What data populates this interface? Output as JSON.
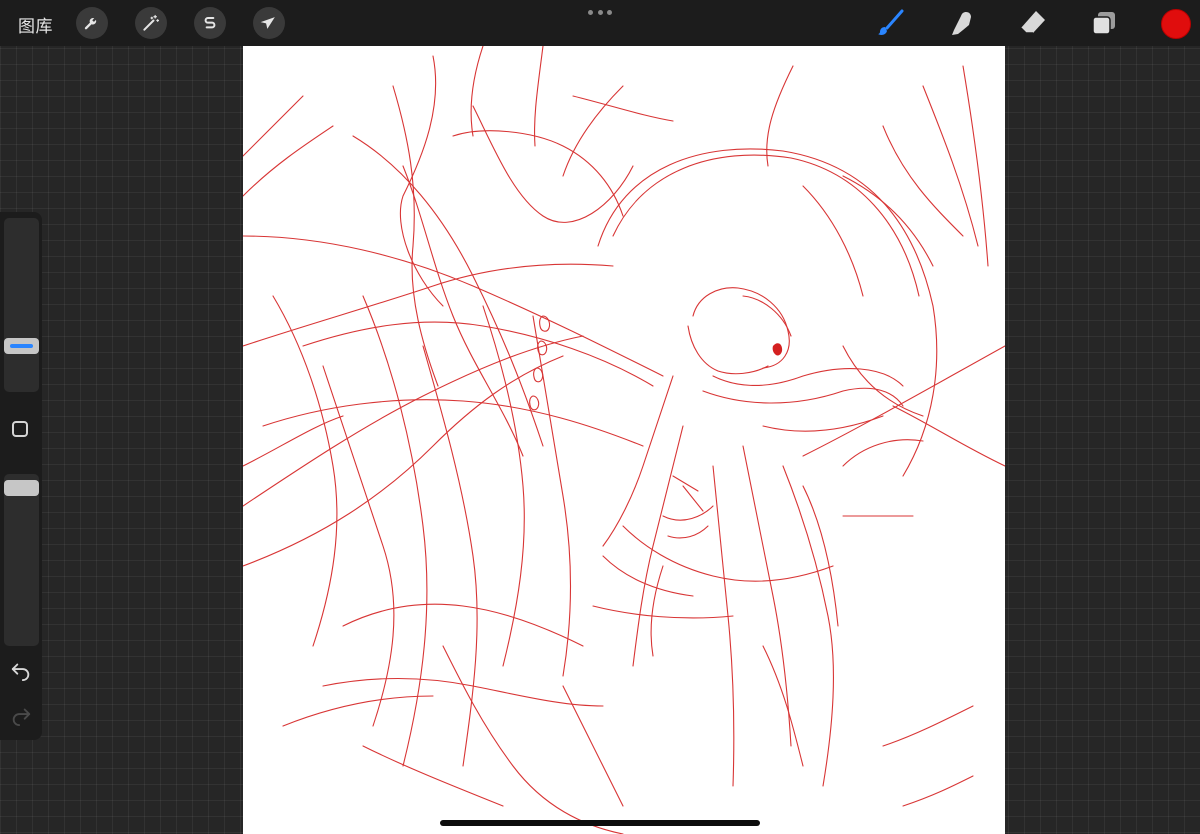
{
  "topbar": {
    "gallery_label": "图库",
    "left_tools": [
      {
        "id": "actions",
        "icon": "wrench-icon"
      },
      {
        "id": "adjustments",
        "icon": "magic-wand-icon"
      },
      {
        "id": "selection",
        "icon": "selection-s-icon"
      },
      {
        "id": "transform",
        "icon": "arrow-cursor-icon"
      }
    ],
    "center": {
      "icon": "more-dots-icon"
    },
    "right_tools": [
      {
        "id": "brush",
        "icon": "brush-icon",
        "active": true
      },
      {
        "id": "smudge",
        "icon": "smudge-finger-icon",
        "active": false
      },
      {
        "id": "eraser",
        "icon": "eraser-icon",
        "active": false
      },
      {
        "id": "layers",
        "icon": "layers-icon",
        "active": false
      }
    ],
    "current_color": "#e00d0d"
  },
  "sidebar": {
    "brush_size_level": 0.78,
    "opacity_level": 1.0,
    "modify_icon": "square-outline-icon",
    "undo_icon": "undo-arrow-icon",
    "redo_icon": "redo-arrow-icon"
  },
  "canvas": {
    "background": "#ffffff",
    "stroke_color": "#d42020"
  },
  "colors": {
    "accent": "#2a85ff",
    "topbar_bg": "#1c1c1c",
    "workspace_bg": "#262626"
  }
}
